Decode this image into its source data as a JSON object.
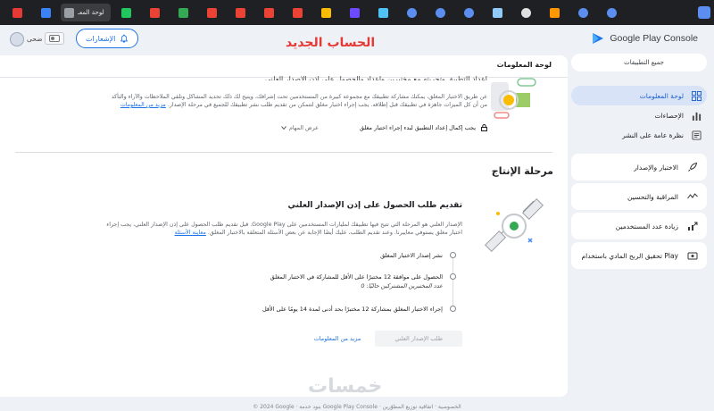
{
  "browser": {
    "active_tab_label": "لوحة المعـ",
    "tab_icons": [
      "chrome",
      "play",
      "gmail",
      "play",
      "gmail",
      "gmail",
      "gmail",
      "gmail",
      "doc",
      "shield",
      "gem",
      "chrome",
      "chrome",
      "chrome",
      "screen",
      "github",
      "film",
      "chrome",
      "chrome"
    ]
  },
  "header": {
    "brand": "Google Play Console",
    "new_account": "الحساب الجديد",
    "notifications": "الإشعارات",
    "mode": "ضحى"
  },
  "sidebar": {
    "all_apps": "جميع التطبيقات",
    "nav": [
      {
        "label": "لوحة المعلومات",
        "icon": "dashboard-icon",
        "active": true
      },
      {
        "label": "الإحصاءات",
        "icon": "bar-chart-icon",
        "active": false
      },
      {
        "label": "نظرة عامة على النشر",
        "icon": "publishing-icon",
        "active": false
      }
    ],
    "cards": [
      {
        "label": "الاختبار والإصدار",
        "icon": "rocket-icon"
      },
      {
        "label": "المراقبة والتحسين",
        "icon": "trend-icon"
      },
      {
        "label": "زيادة عدد المستخدمين",
        "icon": "grow-icon"
      },
      {
        "label": "تحقيق الربح المادي باستخدام Play",
        "icon": "monetize-icon"
      }
    ]
  },
  "main": {
    "title": "لوحة المعلومات",
    "sec1": {
      "cut_title": "إعداد التطبيق وتجربته مع مختبرين وإعداد والحصول على إذن الإصدار العلني",
      "desc": "عن طريق الاختبار المغلق، يمكنك مشاركة تطبيقك مع مجموعة كبيرة من المستخدمين تحت إشرافك، ويتيح لك ذلك تحديد المشاكل وتلقي الملاحظات والآراء والتأكد من أن كل الميزات جاهزة في تطبيقك قبل إطلاقه. يجب إجراء اختبار مغلق لتتمكن من تقديم طلب نشر تطبيقك للجميع في مرحلة الإصدار.",
      "more": "مزيد من المعلومات",
      "locked": "يجب إكمال إعداد التطبيق لبدء إجراء اختبار مغلق",
      "tasks": "عرض المهام"
    },
    "stage_title": "مرحلة الإنتاج",
    "sec2": {
      "title": "تقديم طلب الحصول على إذن الإصدار العلني",
      "desc": "الإصدار العلني هو المرحلة التي تتيح فيها تطبيقك لمليارات المستخدمين على Google Play. قبل تقديم طلب الحصول على إذن الإصدار العلني، يجب إجراء اختبار مغلق يستوفي معاييرنا. وعند تقديم الطلب، عليك أيضًا الإجابة عن بعض الأسئلة المتعلقة بالاختبار المغلق.",
      "more": "معاينة الأسئلة",
      "steps": [
        {
          "text": "نشر إصدار الاختبار المغلق"
        },
        {
          "text": "الحصول على موافقة 12 مختبرًا على الأقل للمشاركة في الاختبار المغلق",
          "sub": "عدد المختبرين المشتركين حاليًا: 0"
        },
        {
          "text": "إجراء الاختبار المغلق بمشاركة 12 مختبرًا بحد أدنى لمدة 14 يومًا على الأقل"
        }
      ],
      "apply": "طلب الإصدار العلني",
      "learn": "مزيد من المعلومات"
    }
  },
  "watermark": "خمسات",
  "footer": "© 2024 Google · بنود خدمة Google Play Console · الخصوصية · اتفاقية توزيع المطوّرين"
}
